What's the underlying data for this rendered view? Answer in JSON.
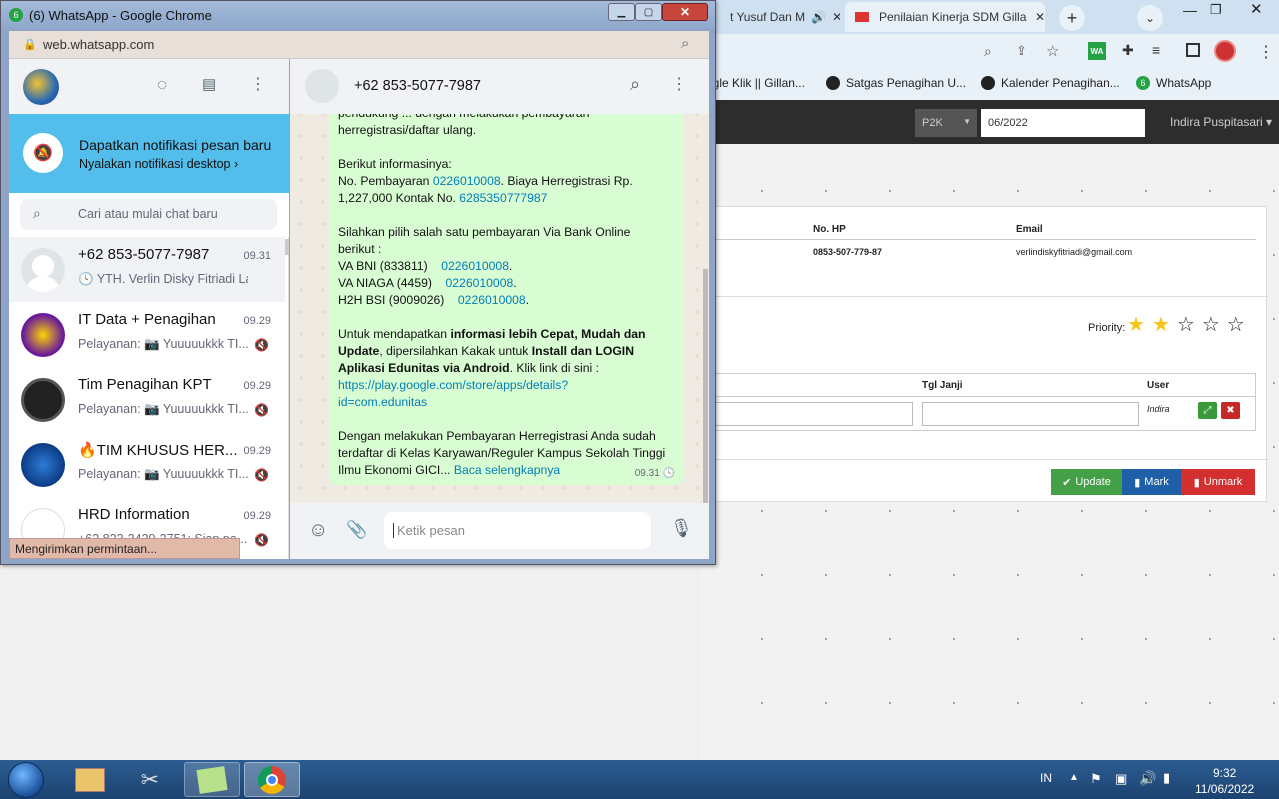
{
  "wa_window": {
    "title": "(6) WhatsApp - Google Chrome",
    "address": "web.whatsapp.com",
    "status_text": "Mengirimkan permintaan...",
    "notif_title": "Dapatkan notifikasi pesan baru",
    "notif_sub": "Nyalakan notifikasi desktop",
    "search_placeholder": "Cari atau mulai chat baru",
    "chats": [
      {
        "name": "+62 853-5077-7987",
        "time": "09.31",
        "preview": "YTH. Verlin Disky Fitriadi Lan..."
      },
      {
        "name": "IT Data + Penagihan",
        "time": "09.29",
        "preview": "Pelayanan: 📷 Yuuuuukkk TI..."
      },
      {
        "name": "Tim Penagihan KPT",
        "time": "09.29",
        "preview": "Pelayanan: 📷 Yuuuuukkk TI..."
      },
      {
        "name": "🔥TIM KHUSUS HER...",
        "time": "09.29",
        "preview": "Pelayanan: 📷 Yuuuuukkk TI..."
      },
      {
        "name": "HRD Information",
        "time": "09.29",
        "preview": "+62 823-3439-2751: Siap pa..."
      }
    ],
    "conversation": {
      "contact": "+62 853-5077-7987",
      "input_placeholder": "Ketik pesan",
      "msg": {
        "l0": "pendukung ... dengan melakukan pembayaran",
        "l1": "herregistrasi/daftar ulang.",
        "l2": "Berikut informasinya:",
        "l3a": "No. Pembayaran ",
        "l3b": "0226010008",
        "l3c": ". Biaya Herregistrasi Rp.",
        "l4a": "1,227,000 Kontak No. ",
        "l4b": "6285350777987",
        "l5": "Silahkan pilih salah satu pembayaran Via Bank Online",
        "l6": "berikut :",
        "l7a": "VA BNI (833811)    ",
        "l7b": "0226010008",
        "l8a": "VA NIAGA (4459)    ",
        "l8b": "0226010008",
        "l9a": "H2H BSI (9009026)    ",
        "l9b": "0226010008",
        "l10a": "Untuk mendapatkan ",
        "l10b": "informasi lebih Cepat, Mudah dan",
        "l11a": "Update",
        "l11b": ", dipersilahkan Kakak untuk ",
        "l11c": "Install dan LOGIN",
        "l12a": "Aplikasi Edunitas via Android",
        "l12b": ". Klik link di sini :",
        "l13": "https://play.google.com/store/apps/details?",
        "l14": "id=com.edunitas",
        "l15": "Dengan melakukan Pembayaran Herregistrasi  Anda sudah",
        "l16": "terdaftar di Kelas Karyawan/Reguler Kampus Sekolah Tinggi",
        "l17a": "Ilmu Ekonomi GICI... ",
        "l17b": "Baca selengkapnya",
        "time": "09.31"
      }
    }
  },
  "bg_browser": {
    "tabs": [
      "t Yusuf Dan M",
      "Penilaian Kinerja SDM Gilla"
    ],
    "bookmarks": [
      "ogle Klik || Gillan...",
      "Satgas Penagihan U...",
      "Kalender Penagihan...",
      "WhatsApp"
    ],
    "select_value": "P2K",
    "period_value": "06/2022",
    "user_name": "Indira Puspitasari",
    "table1_headers": [
      "No. HP",
      "Email"
    ],
    "table1_values": [
      "0853-507-779-87",
      "verlindiskyfitriadi@gmail.com"
    ],
    "priority_label": "Priority:",
    "priority_value": 2,
    "priority_max": 5,
    "table2_headers": [
      "Tgl Janji",
      "User"
    ],
    "table2_user": "Indira",
    "btn_update": "Update",
    "btn_mark": "Mark",
    "btn_unmark": "Unmark"
  },
  "taskbar": {
    "lang": "IN",
    "time": "9:32",
    "date": "11/06/2022"
  }
}
